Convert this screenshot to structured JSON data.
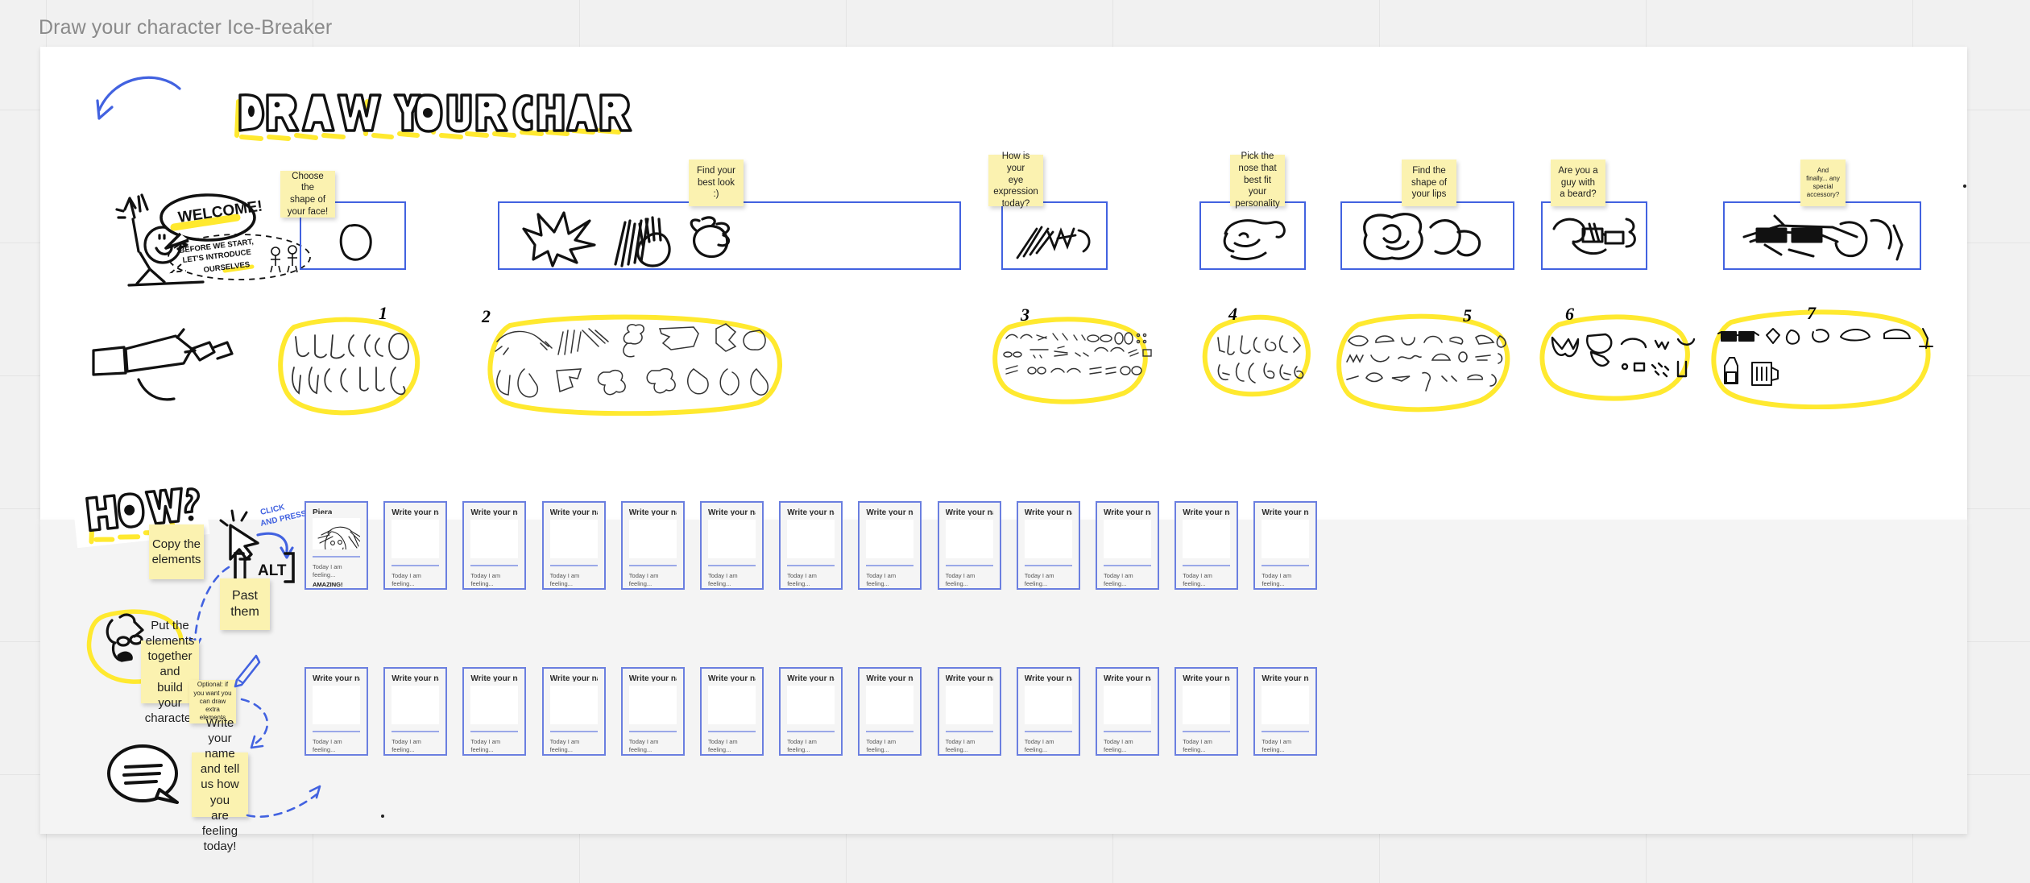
{
  "board": {
    "title": "Draw your character Ice-Breaker",
    "background_color": "#f1f1f1",
    "frame_color": "#ffffff",
    "accent_blue": "#4262e0",
    "sticky_yellow": "#fbf2b0",
    "highlight_yellow": "#ffe92f"
  },
  "headline": {
    "line1": "DRAW YOUR CHARACTER",
    "how_label": "HOW?"
  },
  "mascot": {
    "speech_bubble": "WELCOME!",
    "sub_bubble_line1": "BEFORE WE START,",
    "sub_bubble_line2": "LET'S INTRODUCE",
    "sub_bubble_line3": "OURSELVES"
  },
  "steps": [
    {
      "number": "1",
      "note": "Choose the\nshape of\nyour face!"
    },
    {
      "number": "2",
      "note": "Find your\nbest look\n:)"
    },
    {
      "number": "3",
      "note": "How is your\neye\nexpression\ntoday?"
    },
    {
      "number": "4",
      "note": "Pick the\nnose that\nbest fit your\npersonality"
    },
    {
      "number": "5",
      "note": "Find the\nshape of\nyour lips"
    },
    {
      "number": "6",
      "note": "Are you a\nguy with\na beard?"
    },
    {
      "number": "7",
      "note": "And\nfinally... any\nspecial\naccessory?"
    }
  ],
  "instructions": {
    "copy": "Copy the\nelements",
    "paste": "Past\nthem",
    "click_and_press": "CLICK\nAND PRESS",
    "alt_key": "ALT",
    "build": "Put the\nelements\ntogether and\nbuild your\ncharacter",
    "optional": "Optional: if\nyou want you\ncan draw extra\nelements",
    "write_name": "Write your\nname and tell\nus how you\nare feeling\ntoday!"
  },
  "cards": {
    "name_placeholder": "Write your name here",
    "feeling_prompt": "Today I am feeling...",
    "row1": [
      {
        "name": "Piera",
        "feeling": "AMAZING!",
        "has_drawing": true
      },
      {
        "name": "Write your name here",
        "feeling": "",
        "has_drawing": false
      },
      {
        "name": "Write your name here",
        "feeling": "",
        "has_drawing": false
      },
      {
        "name": "Write your name here",
        "feeling": "",
        "has_drawing": false
      },
      {
        "name": "Write your name here",
        "feeling": "",
        "has_drawing": false
      },
      {
        "name": "Write your name here",
        "feeling": "",
        "has_drawing": false
      },
      {
        "name": "Write your name here",
        "feeling": "",
        "has_drawing": false
      },
      {
        "name": "Write your name here",
        "feeling": "",
        "has_drawing": false
      },
      {
        "name": "Write your name here",
        "feeling": "",
        "has_drawing": false
      },
      {
        "name": "Write your name here",
        "feeling": "",
        "has_drawing": false
      },
      {
        "name": "Write your name here",
        "feeling": "",
        "has_drawing": false
      },
      {
        "name": "Write your name here",
        "feeling": "",
        "has_drawing": false
      },
      {
        "name": "Write your name here",
        "feeling": "",
        "has_drawing": false
      }
    ],
    "row2": [
      {
        "name": "Write your name here",
        "feeling": "",
        "has_drawing": false
      },
      {
        "name": "Write your name here",
        "feeling": "",
        "has_drawing": false
      },
      {
        "name": "Write your name here",
        "feeling": "",
        "has_drawing": false
      },
      {
        "name": "Write your name here",
        "feeling": "",
        "has_drawing": false
      },
      {
        "name": "Write your name here",
        "feeling": "",
        "has_drawing": false
      },
      {
        "name": "Write your name here",
        "feeling": "",
        "has_drawing": false
      },
      {
        "name": "Write your name here",
        "feeling": "",
        "has_drawing": false
      },
      {
        "name": "Write your name here",
        "feeling": "",
        "has_drawing": false
      },
      {
        "name": "Write your name here",
        "feeling": "",
        "has_drawing": false
      },
      {
        "name": "Write your name here",
        "feeling": "",
        "has_drawing": false
      },
      {
        "name": "Write your name here",
        "feeling": "",
        "has_drawing": false
      },
      {
        "name": "Write your name here",
        "feeling": "",
        "has_drawing": false
      },
      {
        "name": "Write your name here",
        "feeling": "",
        "has_drawing": false
      }
    ]
  }
}
